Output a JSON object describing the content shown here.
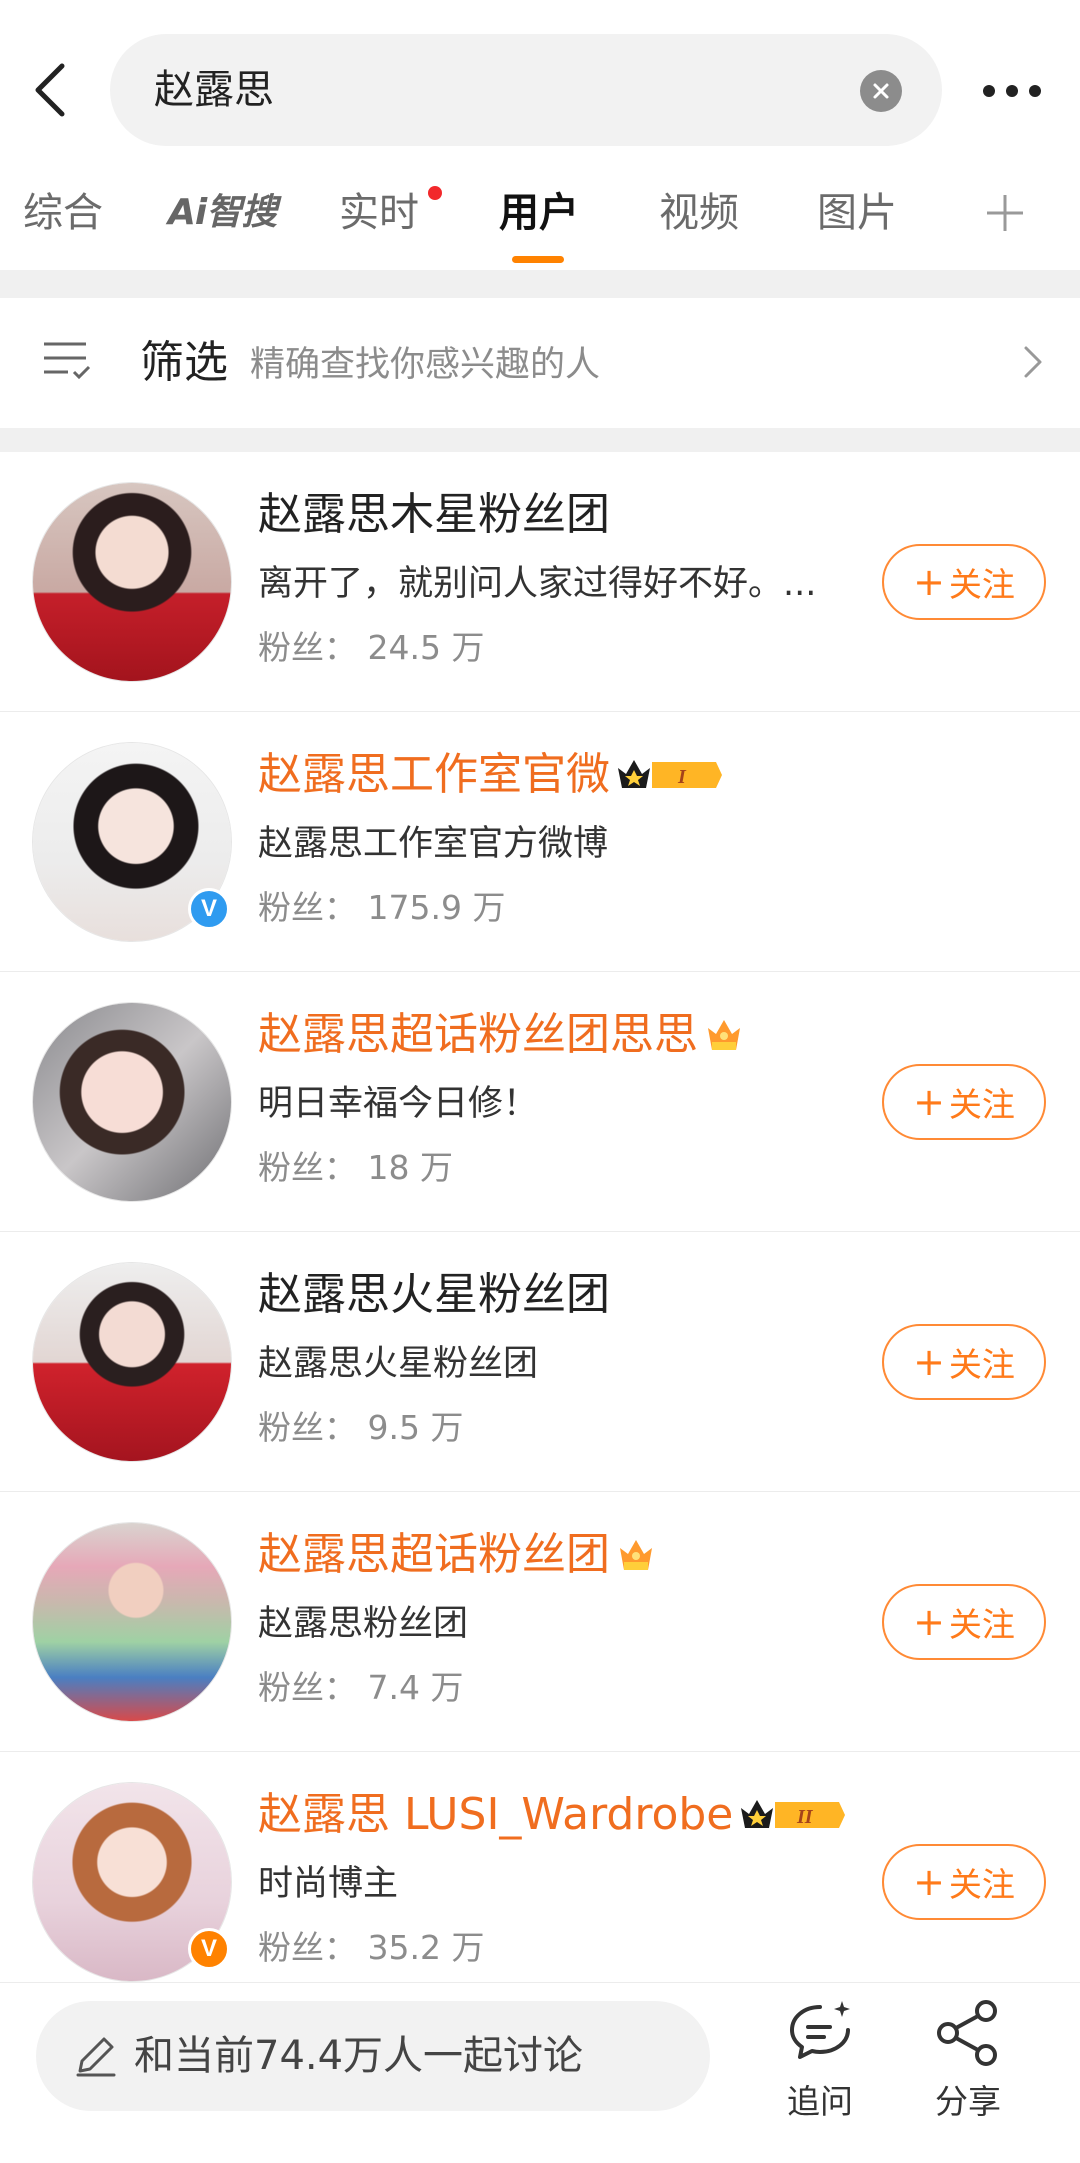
{
  "search": {
    "query": "赵露思"
  },
  "tabs": [
    {
      "label": "综合"
    },
    {
      "label": "Ai智搜"
    },
    {
      "label": "实时"
    },
    {
      "label": "用户"
    },
    {
      "label": "视频"
    },
    {
      "label": "图片"
    }
  ],
  "active_tab": "用户",
  "filter": {
    "title": "筛选",
    "subtitle": "精确查找你感兴趣的人"
  },
  "users": [
    {
      "name": "赵露思木星粉丝团",
      "description": "离开了，就别问人家过得好不好。...",
      "fans": "粉丝：  24.5 万",
      "follow_label": "关注",
      "highlight": false
    },
    {
      "name": "赵露思工作室官微",
      "description": "赵露思工作室官方微博",
      "fans": "粉丝：  175.9 万",
      "follow_label": "",
      "highlight": true,
      "badge": "blue-v",
      "crown_level": "I"
    },
    {
      "name": "赵露思超话粉丝团思思",
      "description": "明日幸福今日修！",
      "fans": "粉丝：  18 万",
      "follow_label": "关注",
      "highlight": true
    },
    {
      "name": "赵露思火星粉丝团",
      "description": "赵露思火星粉丝团",
      "fans": "粉丝：  9.5 万",
      "follow_label": "关注",
      "highlight": false
    },
    {
      "name": "赵露思超话粉丝团",
      "description": "赵露思粉丝团",
      "fans": "粉丝：  7.4 万",
      "follow_label": "关注",
      "highlight": true
    },
    {
      "name": "赵露思 LUSI_Wardrobe",
      "description": "时尚博主",
      "fans": "粉丝：  35.2 万",
      "follow_label": "关注",
      "highlight": true,
      "badge": "orange-v",
      "crown_level": "II"
    }
  ],
  "bottom": {
    "discuss_text": "和当前74.4万人一起讨论",
    "ask_label": "追问",
    "share_label": "分享"
  },
  "colors": {
    "accent": "#ff8200",
    "name_highlight": "#f06d1f",
    "verified_blue": "#2f9bf0",
    "verified_orange": "#ff8200"
  }
}
